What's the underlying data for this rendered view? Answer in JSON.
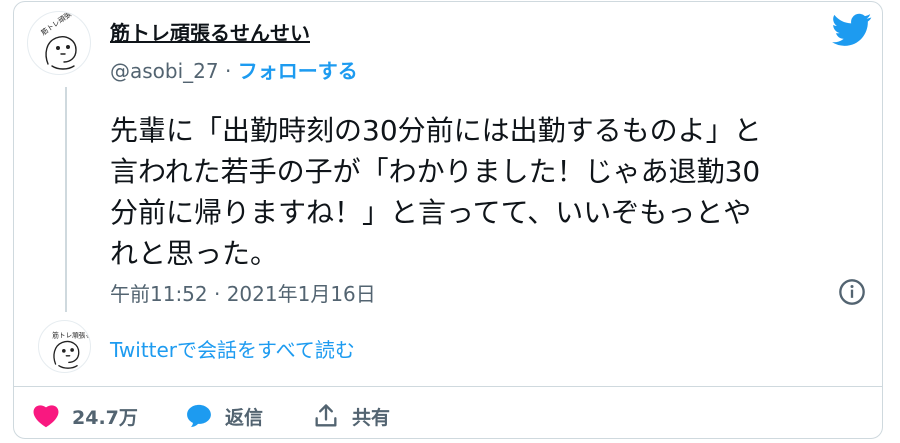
{
  "user": {
    "display_name": "筋トレ頑張るせんせい",
    "handle": "@asobi_27",
    "separator": " · ",
    "follow_label": "フォローする",
    "avatar_text": "筋トレ頑張る"
  },
  "tweet": {
    "lines": [
      "先輩に「出勤時刻の30分前には出勤するものよ」と",
      "言われた若手の子が「わかりました！じゃあ退勤30",
      "分前に帰りますね！」と言ってて、いいぞもっとや",
      "れと思った。"
    ],
    "timestamp": "午前11:52 · 2021年1月16日"
  },
  "thread": {
    "read_all_label": "Twitterで会話をすべて読む"
  },
  "actions": {
    "like_count": "24.7万",
    "reply_label": "返信",
    "share_label": "共有"
  },
  "icons": {
    "brand": "twitter-bird-icon",
    "info": "info-icon",
    "like": "heart-icon",
    "reply": "speech-bubble-icon",
    "share": "share-upload-icon"
  },
  "colors": {
    "brand_blue": "#1d9bf0",
    "like_pink": "#f91880",
    "text_primary": "#0f1419",
    "text_secondary": "#536471",
    "border": "#cfd9de"
  }
}
